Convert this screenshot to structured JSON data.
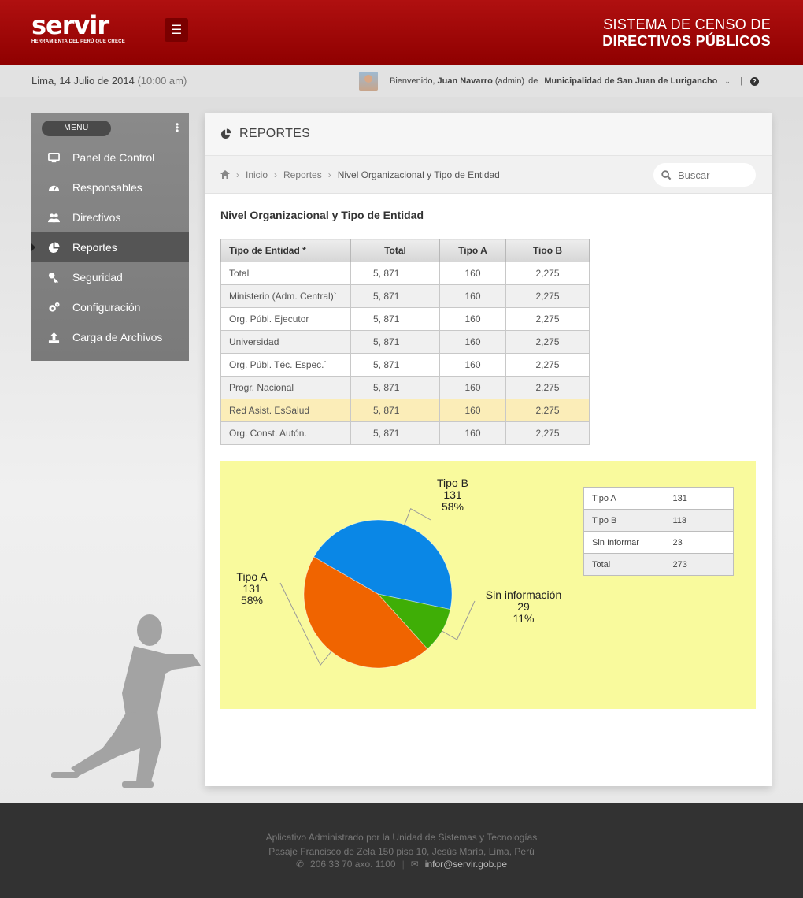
{
  "header": {
    "logo_text": "servir",
    "logo_tagline": "HERRAMIENTA DEL PERÚ QUE CRECE",
    "system_title_line1": "SISTEMA DE CENSO  DE",
    "system_title_line2": "DIRECTIVOS PÚBLICOS",
    "menu_toggle_icon": "hamburger-icon",
    "brand_color": "#a30808"
  },
  "infobar": {
    "date": "Lima, 14 Julio de 2014",
    "time": "(10:00 am)",
    "welcome": "Bienvenido,",
    "user_name": "Juan Navarro",
    "user_role": "(admin)",
    "of": "de",
    "organization": "Municipalidad de San Juan de Lurigancho",
    "separator": "|"
  },
  "sidebar": {
    "menu_label": "MENU",
    "items": [
      {
        "label": "Panel de Control",
        "icon": "monitor-icon"
      },
      {
        "label": "Responsables",
        "icon": "dashboard-icon"
      },
      {
        "label": "Directivos",
        "icon": "users-icon"
      },
      {
        "label": "Reportes",
        "icon": "pie-chart-icon",
        "active": true
      },
      {
        "label": "Seguridad",
        "icon": "key-icon"
      },
      {
        "label": "Configuración",
        "icon": "gears-icon"
      },
      {
        "label": "Carga de Archivos",
        "icon": "upload-icon"
      }
    ]
  },
  "main": {
    "title": "REPORTES",
    "breadcrumb": [
      "Inicio",
      "Reportes",
      "Nivel Organizacional y Tipo de Entidad"
    ],
    "search_placeholder": "Buscar",
    "section_title": "Nivel Organizacional y Tipo de Entidad",
    "table": {
      "headers": [
        "Tipo de Entidad *",
        "Total",
        "Tipo A",
        "Tioo B"
      ],
      "rows": [
        [
          "Total",
          "5, 871",
          "160",
          "2,275"
        ],
        [
          "Ministerio (Adm. Central)`",
          "5, 871",
          "160",
          "2,275"
        ],
        [
          "Org. Públ. Ejecutor",
          "5, 871",
          "160",
          "2,275"
        ],
        [
          "Universidad",
          "5, 871",
          "160",
          "2,275"
        ],
        [
          "Org. Públ. Téc. Espec.`",
          "5, 871",
          "160",
          "2,275"
        ],
        [
          "Progr. Nacional",
          "5, 871",
          "160",
          "2,275"
        ],
        [
          "Red Asist. EsSalud",
          "5, 871",
          "160",
          "2,275"
        ],
        [
          "Org. Const. Autón.",
          "5, 871",
          "160",
          "2,275"
        ]
      ],
      "highlighted_row": 6
    },
    "legend_table": [
      [
        "Tipo A",
        "131"
      ],
      [
        "Tipo B",
        "113"
      ],
      [
        "Sin Informar",
        "23"
      ],
      [
        "Total",
        "273"
      ]
    ]
  },
  "chart_data": {
    "type": "pie",
    "slices": [
      {
        "name": "Tipo B",
        "value": 131,
        "label_value": "131",
        "label_pct": "58%",
        "color": "#0a87e6"
      },
      {
        "name": "Sin información",
        "value": 29,
        "label_value": "29",
        "label_pct": "11%",
        "color": "#3fae06"
      },
      {
        "name": "Tipo A",
        "value": 131,
        "label_value": "131",
        "label_pct": "58%",
        "color": "#f06400"
      }
    ],
    "background": "#f9fa9d"
  },
  "footer": {
    "line1": "Aplicativo Administrado por la Unidad de Sistemas y Tecnologías",
    "line2": "Pasaje Francisco de Zela 150 piso 10, Jesús María, Lima, Perú",
    "phone": "206 33 70 axo. 1100",
    "email": "infor@servir.gob.pe"
  }
}
